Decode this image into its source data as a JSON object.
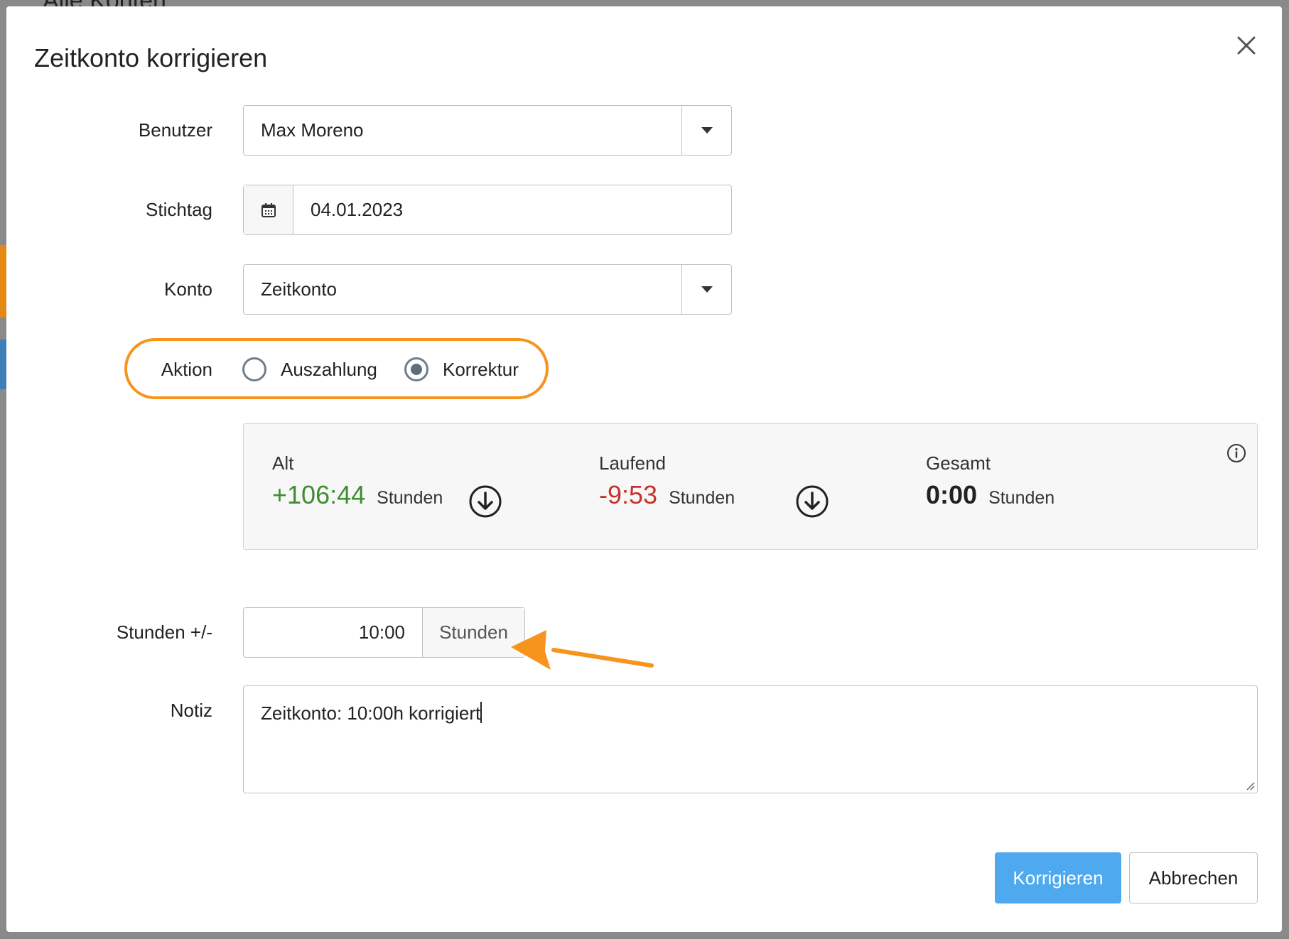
{
  "background": {
    "page_title": "Alle Konten"
  },
  "dialog": {
    "title": "Zeitkonto korrigieren",
    "close_icon": "close-icon"
  },
  "form": {
    "user": {
      "label": "Benutzer",
      "value": "Max Moreno"
    },
    "date": {
      "label": "Stichtag",
      "value": "04.01.2023",
      "icon": "calendar-icon"
    },
    "account": {
      "label": "Konto",
      "value": "Zeitkonto"
    },
    "action": {
      "label": "Aktion",
      "options": [
        {
          "label": "Auszahlung",
          "selected": false
        },
        {
          "label": "Korrektur",
          "selected": true
        }
      ]
    },
    "hours": {
      "label": "Stunden +/-",
      "value": "10:00",
      "unit": "Stunden"
    },
    "note": {
      "label": "Notiz",
      "value": "Zeitkonto: 10:00h korrigiert"
    }
  },
  "summary": {
    "old": {
      "label": "Alt",
      "value": "+106:44",
      "unit": "Stunden",
      "color": "#3e8e2f"
    },
    "current": {
      "label": "Laufend",
      "value": "-9:53",
      "unit": "Stunden",
      "color": "#c8302c"
    },
    "total": {
      "label": "Gesamt",
      "value": "0:00",
      "unit": "Stunden",
      "color": "#222222"
    }
  },
  "buttons": {
    "submit": "Korrigieren",
    "cancel": "Abbrechen"
  },
  "colors": {
    "highlight": "#f7941d",
    "primary": "#4fa9ee"
  }
}
